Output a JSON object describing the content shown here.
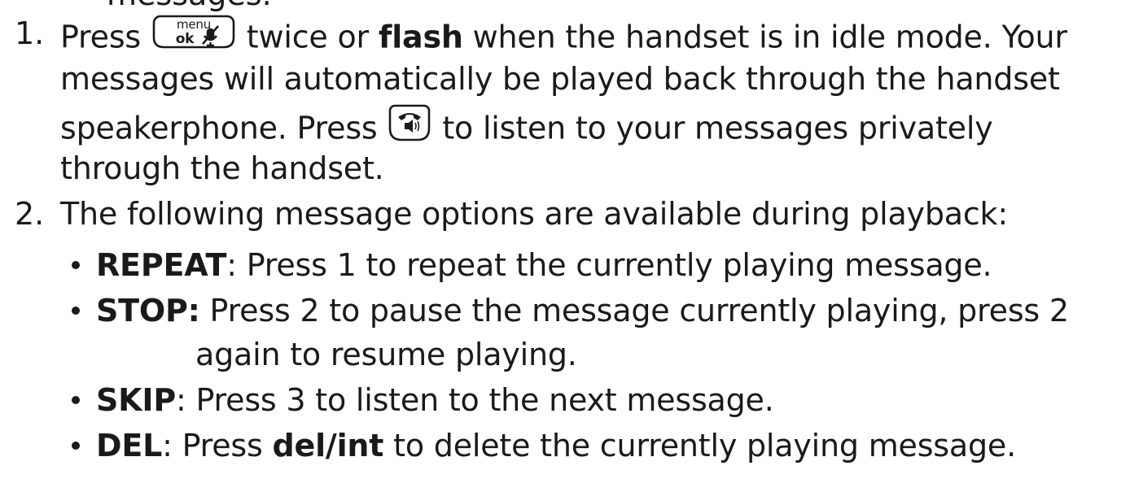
{
  "partial_top_line": "messages.",
  "step1": {
    "number": "1.",
    "line1_a": "Press",
    "line1_b": "twice or",
    "line1_bold": "flash",
    "line1_c": "when the handset is in idle mode. Your",
    "line2": "messages will automatically be played back through the handset",
    "line3_a": "speakerphone. Press",
    "line3_b": "to listen to your messages privately",
    "line4": "through the handset."
  },
  "step2": {
    "number": "2.",
    "text": "The following message options are available during playback:"
  },
  "options": [
    {
      "label": "REPEAT",
      "sep": ": ",
      "text": "Press 1 to repeat the currently playing message."
    },
    {
      "label": "STOP:",
      "sep": " ",
      "text": "Press 2 to pause the message currently playing, press 2",
      "continuation": "again to resume playing."
    },
    {
      "label": "SKIP",
      "sep": ": ",
      "text": "Press 3 to listen to the next message."
    },
    {
      "label": "DEL",
      "sep": ": ",
      "text_a": "Press",
      "bold": "del/int",
      "text_b": "to delete the currently playing message."
    }
  ],
  "icons": {
    "menu_key": {
      "name": "menu-ok-mute-key-icon",
      "top_text": "menu",
      "bottom_text": "ok"
    },
    "speaker_key": {
      "name": "speakerphone-key-icon"
    }
  }
}
